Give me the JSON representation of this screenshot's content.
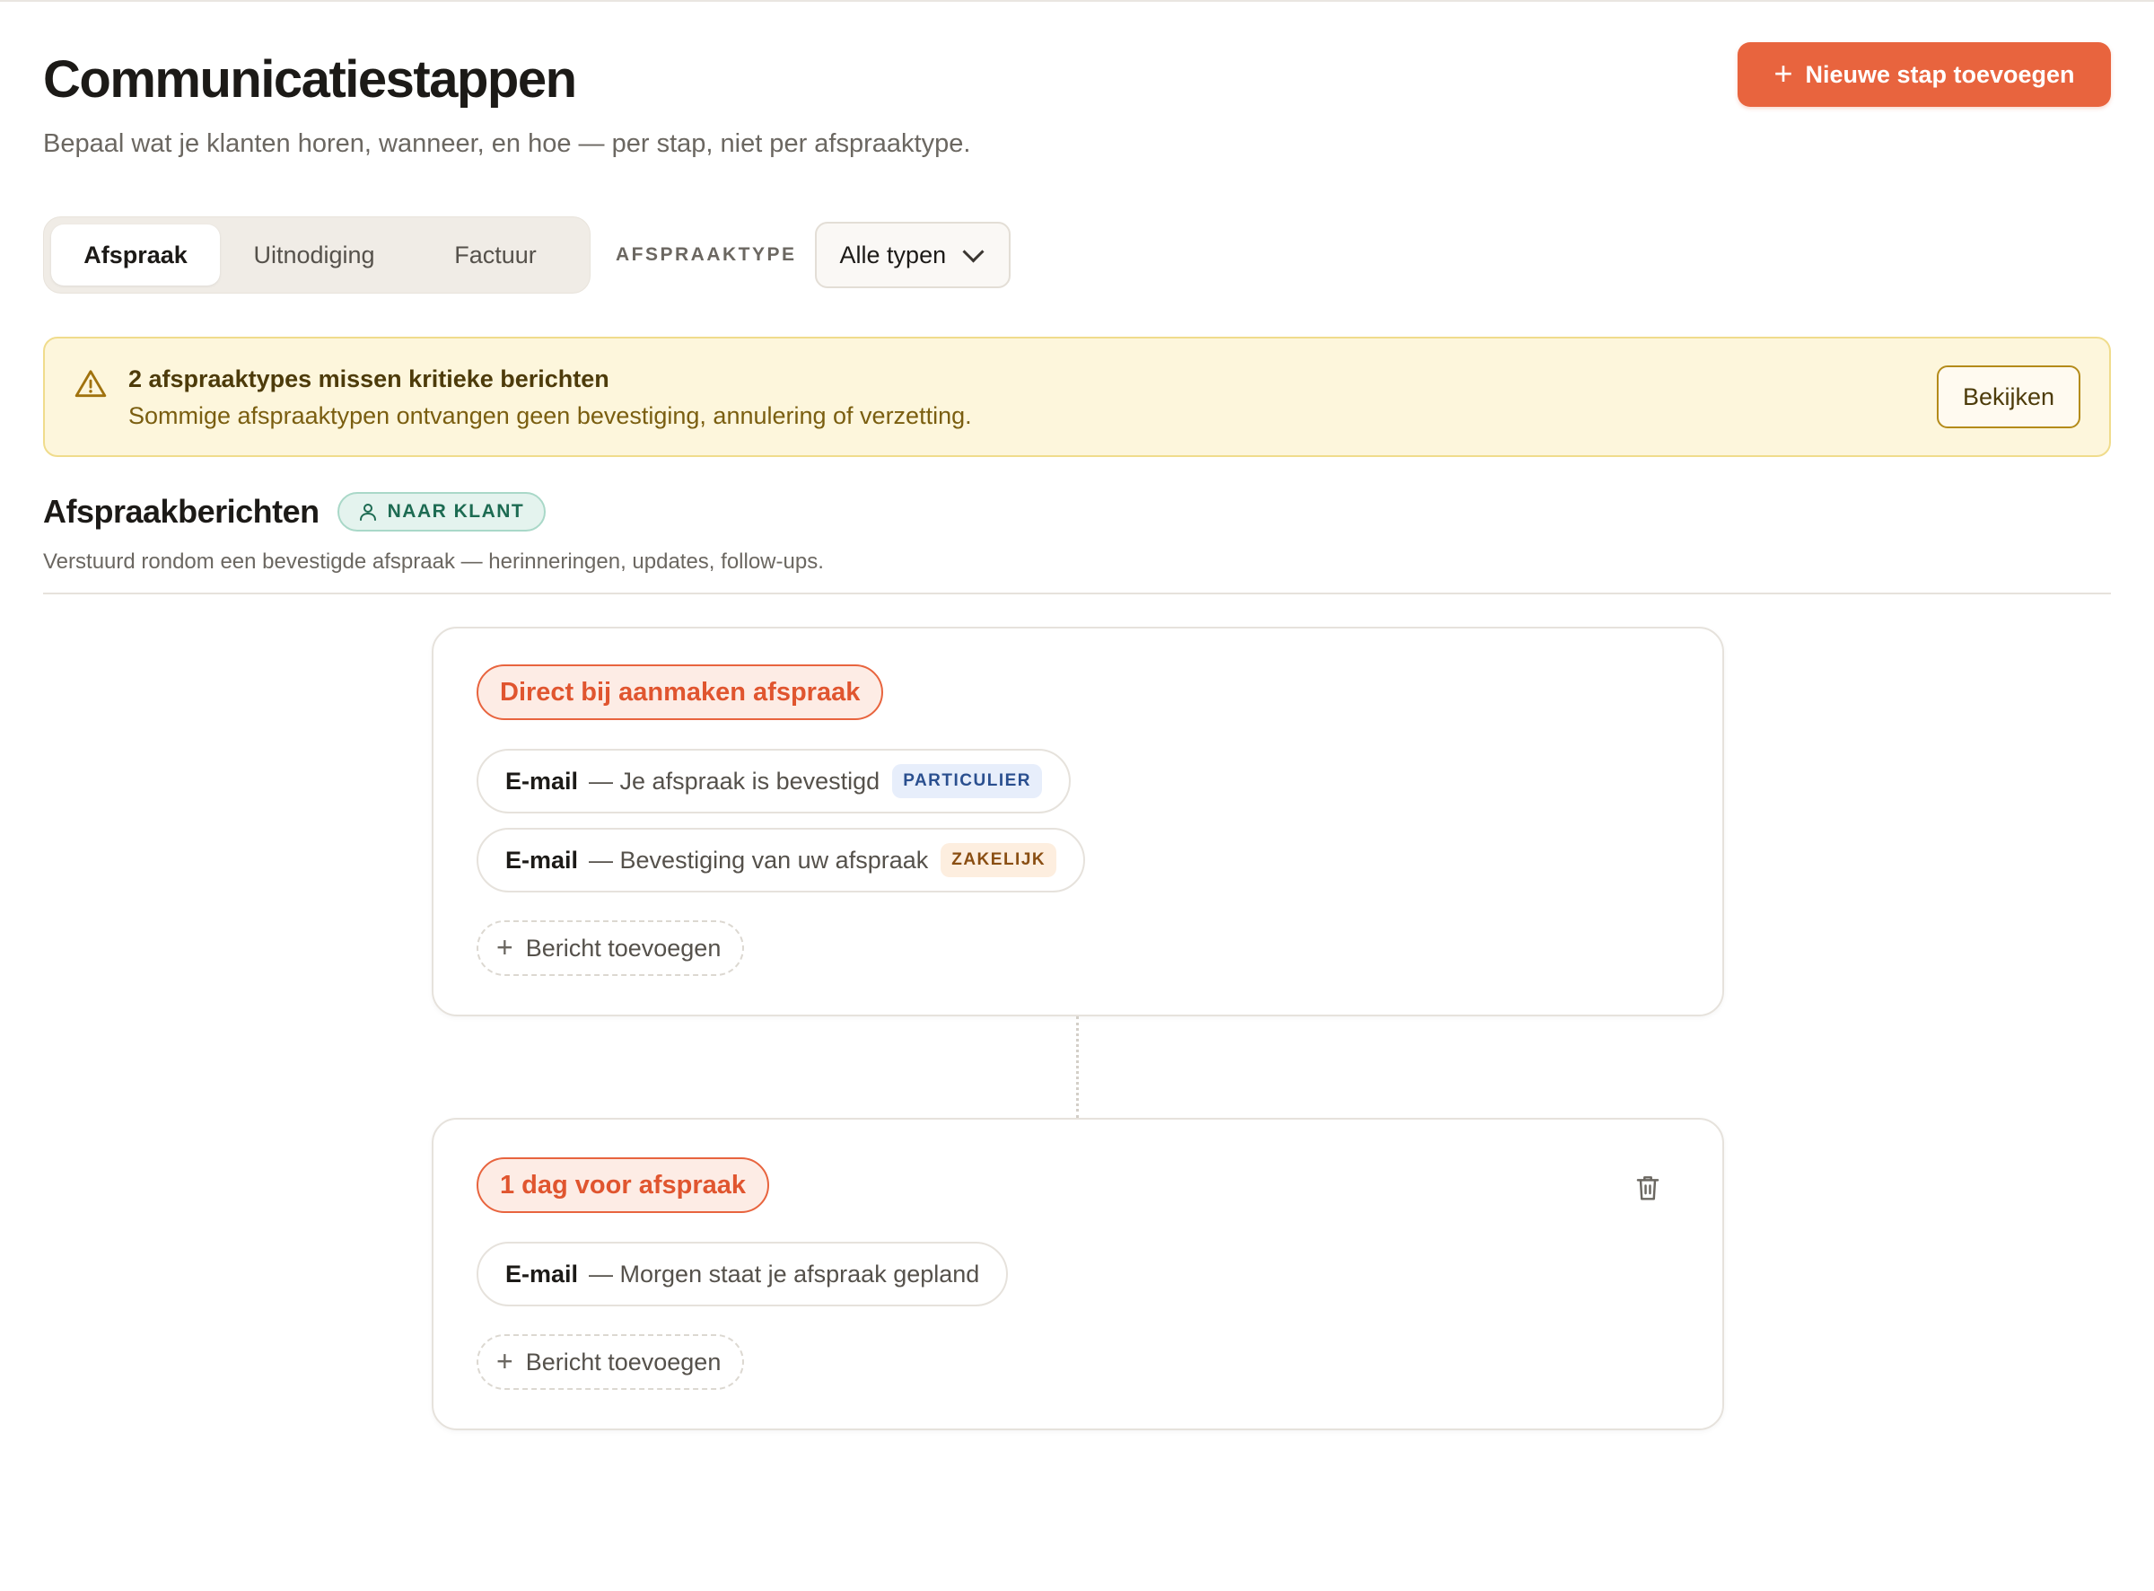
{
  "header": {
    "title": "Communicatiestappen",
    "subtitle": "Bepaal wat je klanten horen, wanneer, en hoe — per stap, niet per afspraaktype.",
    "new_step_label": "Nieuwe stap toevoegen"
  },
  "filters": {
    "tabs": [
      {
        "label": "Afspraak",
        "active": true
      },
      {
        "label": "Uitnodiging",
        "active": false
      },
      {
        "label": "Factuur",
        "active": false
      }
    ],
    "type_label": "AFSPRAAKTYPE",
    "type_value": "Alle typen"
  },
  "alert": {
    "title": "2 afspraaktypes missen kritieke berichten",
    "text": "Sommige afspraaktypen ontvangen geen bevestiging, annulering of verzetting.",
    "action_label": "Bekijken"
  },
  "section": {
    "title": "Afspraakberichten",
    "audience_badge": "NAAR KLANT",
    "description": "Verstuurd rondom een bevestigde afspraak — herinneringen, updates, follow-ups."
  },
  "steps": [
    {
      "timing": "Direct bij aanmaken afspraak",
      "messages": [
        {
          "channel": "E-mail",
          "subject": "— Je afspraak is bevestigd",
          "tag": "PARTICULIER"
        },
        {
          "channel": "E-mail",
          "subject": "— Bevestiging van uw afspraak",
          "tag": "ZAKELIJK"
        }
      ],
      "add_label": "Bericht toevoegen"
    },
    {
      "timing": "1 dag voor afspraak",
      "messages": [
        {
          "channel": "E-mail",
          "subject": "— Morgen staat je afspraak gepland"
        }
      ],
      "add_label": "Bericht toevoegen"
    }
  ],
  "colors": {
    "accent": "#e8643e",
    "alert_bg": "#fdf6dc",
    "audience_green": "#1d6b52"
  }
}
